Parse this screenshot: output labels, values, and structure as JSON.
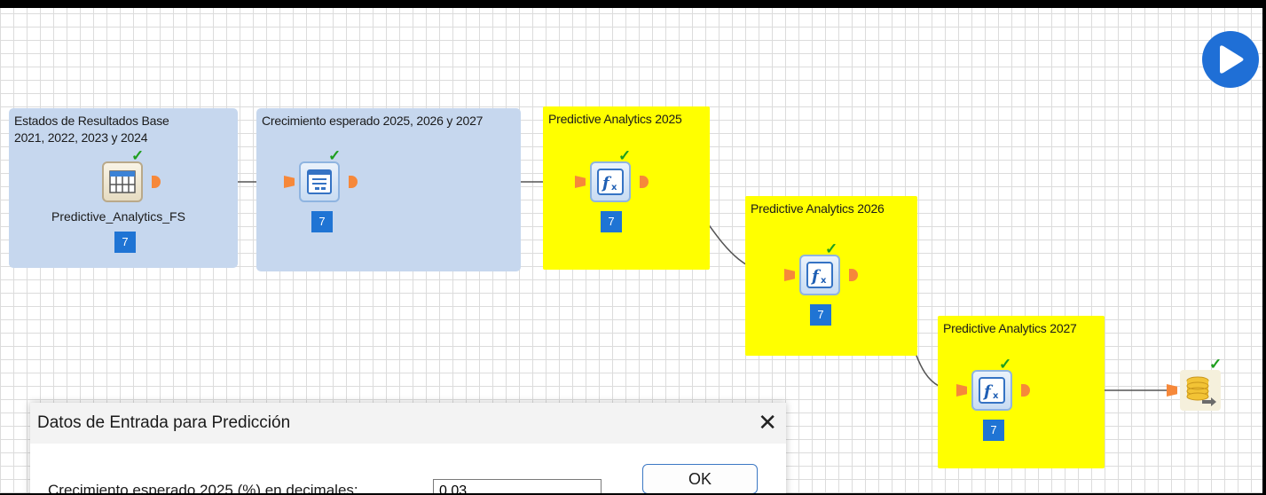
{
  "run_button": {
    "icon": "play-icon",
    "color": "#1f6fd6"
  },
  "groups": [
    {
      "id": "estados",
      "title": "Estados de Resultados Base\n2021, 2022, 2023 y 2024",
      "color": "#c6d7ee"
    },
    {
      "id": "crecimiento",
      "title": "Crecimiento esperado 2025, 2026 y 2027",
      "color": "#c6d7ee"
    },
    {
      "id": "pa2025",
      "title": "Predictive Analytics 2025",
      "color": "#ffff00"
    },
    {
      "id": "pa2026",
      "title": "Predictive Analytics 2026",
      "color": "#ffff00"
    },
    {
      "id": "pa2027",
      "title": "Predictive Analytics 2027",
      "color": "#ffff00"
    }
  ],
  "steps": [
    {
      "id": "table-input",
      "icon": "table-icon",
      "label": "Predictive_Analytics_FS",
      "badge": "7",
      "status": "ok"
    },
    {
      "id": "user-input",
      "icon": "form-dialog-icon",
      "label": "",
      "badge": "7",
      "status": "ok"
    },
    {
      "id": "formula-2025",
      "icon": "formula-icon",
      "label": "",
      "badge": "7",
      "status": "ok"
    },
    {
      "id": "formula-2026",
      "icon": "formula-icon",
      "label": "",
      "badge": "7",
      "status": "ok"
    },
    {
      "id": "formula-2027",
      "icon": "formula-icon",
      "label": "",
      "badge": "7",
      "status": "ok"
    },
    {
      "id": "output",
      "icon": "database-output-icon",
      "label": "",
      "badge": "",
      "status": "ok"
    }
  ],
  "check_glyph": "✓",
  "dialog": {
    "title": "Datos de Entrada para Predicción",
    "close_glyph": "✕",
    "field_label": "Crecimiento esperado 2025 (%) en decimales:",
    "field_value": "0.03",
    "ok_label": "OK"
  }
}
